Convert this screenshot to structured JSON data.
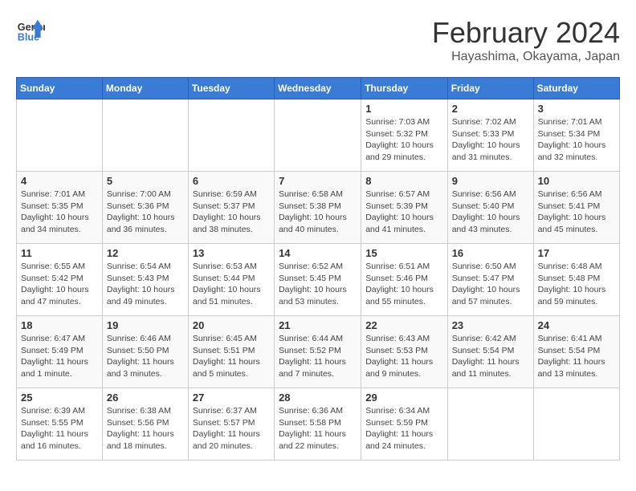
{
  "logo": {
    "line1": "General",
    "line2": "Blue"
  },
  "header": {
    "month": "February 2024",
    "location": "Hayashima, Okayama, Japan"
  },
  "weekdays": [
    "Sunday",
    "Monday",
    "Tuesday",
    "Wednesday",
    "Thursday",
    "Friday",
    "Saturday"
  ],
  "weeks": [
    [
      {
        "day": "",
        "info": ""
      },
      {
        "day": "",
        "info": ""
      },
      {
        "day": "",
        "info": ""
      },
      {
        "day": "",
        "info": ""
      },
      {
        "day": "1",
        "info": "Sunrise: 7:03 AM\nSunset: 5:32 PM\nDaylight: 10 hours\nand 29 minutes."
      },
      {
        "day": "2",
        "info": "Sunrise: 7:02 AM\nSunset: 5:33 PM\nDaylight: 10 hours\nand 31 minutes."
      },
      {
        "day": "3",
        "info": "Sunrise: 7:01 AM\nSunset: 5:34 PM\nDaylight: 10 hours\nand 32 minutes."
      }
    ],
    [
      {
        "day": "4",
        "info": "Sunrise: 7:01 AM\nSunset: 5:35 PM\nDaylight: 10 hours\nand 34 minutes."
      },
      {
        "day": "5",
        "info": "Sunrise: 7:00 AM\nSunset: 5:36 PM\nDaylight: 10 hours\nand 36 minutes."
      },
      {
        "day": "6",
        "info": "Sunrise: 6:59 AM\nSunset: 5:37 PM\nDaylight: 10 hours\nand 38 minutes."
      },
      {
        "day": "7",
        "info": "Sunrise: 6:58 AM\nSunset: 5:38 PM\nDaylight: 10 hours\nand 40 minutes."
      },
      {
        "day": "8",
        "info": "Sunrise: 6:57 AM\nSunset: 5:39 PM\nDaylight: 10 hours\nand 41 minutes."
      },
      {
        "day": "9",
        "info": "Sunrise: 6:56 AM\nSunset: 5:40 PM\nDaylight: 10 hours\nand 43 minutes."
      },
      {
        "day": "10",
        "info": "Sunrise: 6:56 AM\nSunset: 5:41 PM\nDaylight: 10 hours\nand 45 minutes."
      }
    ],
    [
      {
        "day": "11",
        "info": "Sunrise: 6:55 AM\nSunset: 5:42 PM\nDaylight: 10 hours\nand 47 minutes."
      },
      {
        "day": "12",
        "info": "Sunrise: 6:54 AM\nSunset: 5:43 PM\nDaylight: 10 hours\nand 49 minutes."
      },
      {
        "day": "13",
        "info": "Sunrise: 6:53 AM\nSunset: 5:44 PM\nDaylight: 10 hours\nand 51 minutes."
      },
      {
        "day": "14",
        "info": "Sunrise: 6:52 AM\nSunset: 5:45 PM\nDaylight: 10 hours\nand 53 minutes."
      },
      {
        "day": "15",
        "info": "Sunrise: 6:51 AM\nSunset: 5:46 PM\nDaylight: 10 hours\nand 55 minutes."
      },
      {
        "day": "16",
        "info": "Sunrise: 6:50 AM\nSunset: 5:47 PM\nDaylight: 10 hours\nand 57 minutes."
      },
      {
        "day": "17",
        "info": "Sunrise: 6:48 AM\nSunset: 5:48 PM\nDaylight: 10 hours\nand 59 minutes."
      }
    ],
    [
      {
        "day": "18",
        "info": "Sunrise: 6:47 AM\nSunset: 5:49 PM\nDaylight: 11 hours\nand 1 minute."
      },
      {
        "day": "19",
        "info": "Sunrise: 6:46 AM\nSunset: 5:50 PM\nDaylight: 11 hours\nand 3 minutes."
      },
      {
        "day": "20",
        "info": "Sunrise: 6:45 AM\nSunset: 5:51 PM\nDaylight: 11 hours\nand 5 minutes."
      },
      {
        "day": "21",
        "info": "Sunrise: 6:44 AM\nSunset: 5:52 PM\nDaylight: 11 hours\nand 7 minutes."
      },
      {
        "day": "22",
        "info": "Sunrise: 6:43 AM\nSunset: 5:53 PM\nDaylight: 11 hours\nand 9 minutes."
      },
      {
        "day": "23",
        "info": "Sunrise: 6:42 AM\nSunset: 5:54 PM\nDaylight: 11 hours\nand 11 minutes."
      },
      {
        "day": "24",
        "info": "Sunrise: 6:41 AM\nSunset: 5:54 PM\nDaylight: 11 hours\nand 13 minutes."
      }
    ],
    [
      {
        "day": "25",
        "info": "Sunrise: 6:39 AM\nSunset: 5:55 PM\nDaylight: 11 hours\nand 16 minutes."
      },
      {
        "day": "26",
        "info": "Sunrise: 6:38 AM\nSunset: 5:56 PM\nDaylight: 11 hours\nand 18 minutes."
      },
      {
        "day": "27",
        "info": "Sunrise: 6:37 AM\nSunset: 5:57 PM\nDaylight: 11 hours\nand 20 minutes."
      },
      {
        "day": "28",
        "info": "Sunrise: 6:36 AM\nSunset: 5:58 PM\nDaylight: 11 hours\nand 22 minutes."
      },
      {
        "day": "29",
        "info": "Sunrise: 6:34 AM\nSunset: 5:59 PM\nDaylight: 11 hours\nand 24 minutes."
      },
      {
        "day": "",
        "info": ""
      },
      {
        "day": "",
        "info": ""
      }
    ]
  ]
}
